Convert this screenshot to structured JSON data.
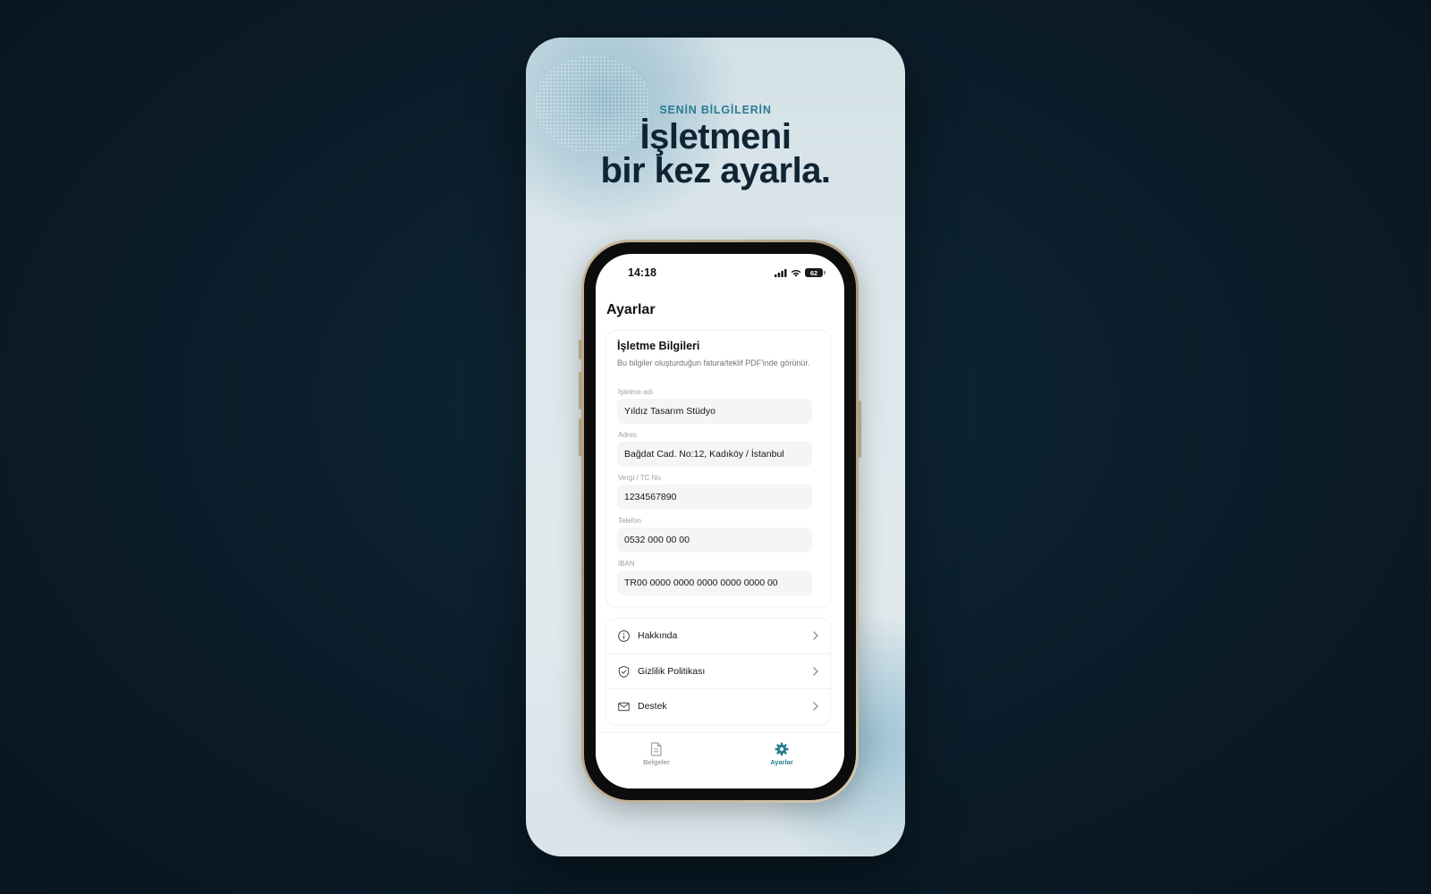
{
  "hero": {
    "eyebrow": "SENİN BİLGİLERİN",
    "headline_line1": "İşletmeni",
    "headline_line2": "bir kez ayarla."
  },
  "status_bar": {
    "time": "14:18",
    "battery": "62"
  },
  "screen": {
    "title": "Ayarlar",
    "business_section": {
      "title": "İşletme Bilgileri",
      "description": "Bu bilgiler oluşturduğun fatura/teklif PDF'inde görünür.",
      "fields": [
        {
          "label": "İşletme adı",
          "value": "Yıldız Tasarım Stüdyo"
        },
        {
          "label": "Adres",
          "value": "Bağdat Cad. No:12, Kadıköy / İstanbul"
        },
        {
          "label": "Vergi / TC No",
          "value": "1234567890"
        },
        {
          "label": "Telefon",
          "value": "0532 000 00 00"
        },
        {
          "label": "IBAN",
          "value": "TR00 0000 0000 0000 0000 0000 00"
        }
      ]
    },
    "menu": [
      {
        "label": "Hakkında",
        "icon": "info-icon"
      },
      {
        "label": "Gizlilik Politikası",
        "icon": "shield-icon"
      },
      {
        "label": "Destek",
        "icon": "mail-icon"
      }
    ],
    "tabs": [
      {
        "label": "Belgeler",
        "icon": "document-icon",
        "active": false
      },
      {
        "label": "Ayarlar",
        "icon": "gear-icon",
        "active": true
      }
    ]
  },
  "colors": {
    "accent": "#2a7d92",
    "headline": "#0f2533",
    "tab_inactive": "#9aa1a7"
  }
}
